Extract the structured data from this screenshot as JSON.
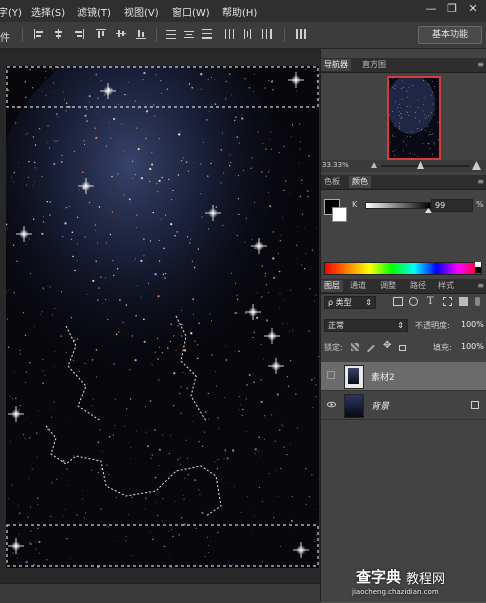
{
  "menubar": {
    "items": [
      {
        "label": "字(Y)"
      },
      {
        "label": "选择(S)"
      },
      {
        "label": "滤镜(T)"
      },
      {
        "label": "视图(V)"
      },
      {
        "label": "窗口(W)"
      },
      {
        "label": "帮助(H)"
      }
    ],
    "window_buttons": {
      "minimize": "—",
      "restore": "❐",
      "close": "✕"
    }
  },
  "optionsbar": {
    "left_label": "件",
    "workspace_label": "基本功能"
  },
  "navigator": {
    "tabs": [
      "导航器",
      "直方图"
    ],
    "zoom": "33.33%"
  },
  "color_panel": {
    "tabs": [
      "色板",
      "颜色"
    ],
    "channel_label": "K",
    "value": "99",
    "unit": "%",
    "value_fraction": 0.99
  },
  "layers_panel": {
    "tabs": [
      "图层",
      "通道",
      "调整",
      "路径",
      "样式"
    ],
    "filter_label": "ρ 类型",
    "blend_mode": "正常",
    "opacity_label": "不透明度:",
    "opacity_value": "100%",
    "lock_label": "锁定:",
    "fill_label": "填充:",
    "fill_value": "100%",
    "layers": [
      {
        "name": "素材2",
        "visible": false,
        "locked": false,
        "selected": true
      },
      {
        "name": "背景",
        "visible": true,
        "locked": true,
        "selected": false
      }
    ]
  },
  "watermark": {
    "line1_a": "查字典",
    "line1_b": "教程网",
    "line2": "jiaocheng.chazidian.com"
  },
  "colors": {
    "menubar": "#2f2f2f",
    "accent_red": "#d63a3a"
  }
}
